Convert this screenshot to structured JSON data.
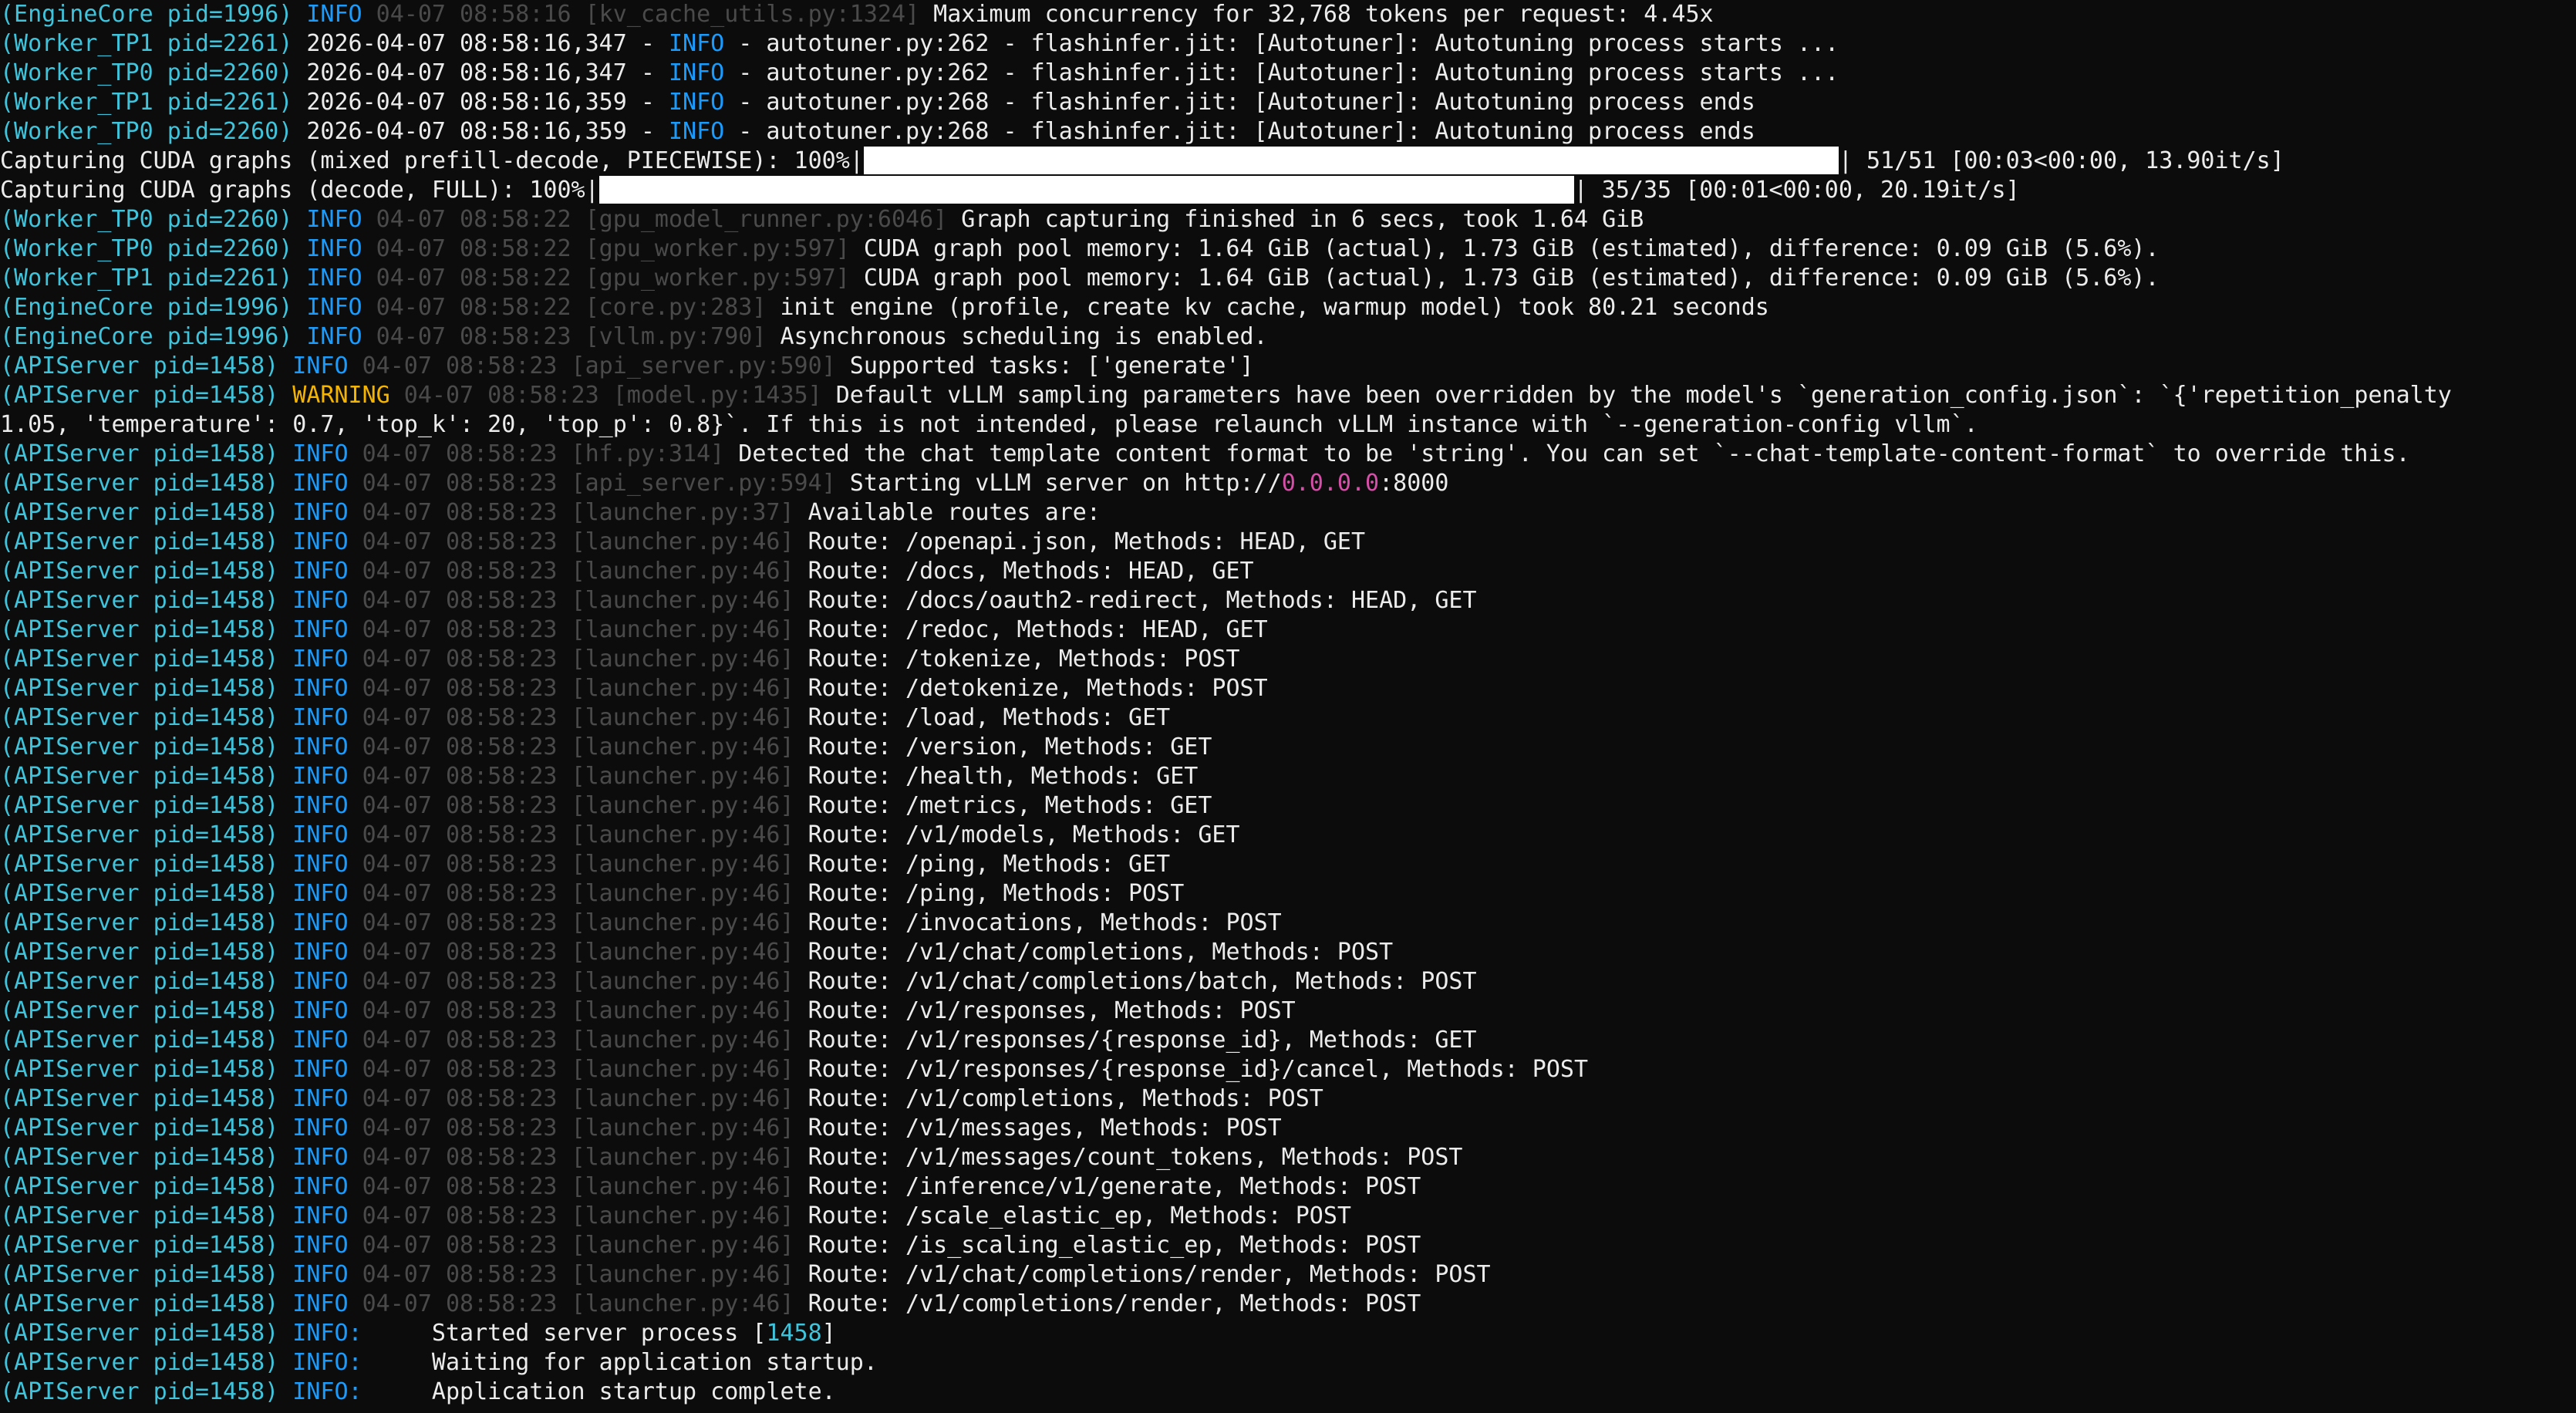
{
  "colors": {
    "background": "#0c0c0c",
    "prefix": "#3fc4dc",
    "info": "#1a9cff",
    "warning": "#f5b400",
    "meta": "#4a4a4a",
    "text": "#ececec",
    "url_highlight": "#d64fa8",
    "progress_fill": "#ffffff"
  },
  "lines": [
    {
      "type": "log",
      "prefix": "(EngineCore pid=1996)",
      "level": "INFO",
      "meta": "04-07 08:58:16 [kv_cache_utils.py:1324]",
      "msg": "Maximum concurrency for 32,768 tokens per request: 4.45x"
    },
    {
      "type": "plain",
      "prefix": "(Worker_TP1 pid=2261)",
      "pre": "2026-04-07 08:58:16,347 - ",
      "level": "INFO",
      "msg": " - autotuner.py:262 - flashinfer.jit: [Autotuner]: Autotuning process starts ..."
    },
    {
      "type": "plain",
      "prefix": "(Worker_TP0 pid=2260)",
      "pre": "2026-04-07 08:58:16,347 - ",
      "level": "INFO",
      "msg": " - autotuner.py:262 - flashinfer.jit: [Autotuner]: Autotuning process starts ..."
    },
    {
      "type": "plain",
      "prefix": "(Worker_TP1 pid=2261)",
      "pre": "2026-04-07 08:58:16,359 - ",
      "level": "INFO",
      "msg": " - autotuner.py:268 - flashinfer.jit: [Autotuner]: Autotuning process ends"
    },
    {
      "type": "plain",
      "prefix": "(Worker_TP0 pid=2260)",
      "pre": "2026-04-07 08:58:16,359 - ",
      "level": "INFO",
      "msg": " - autotuner.py:268 - flashinfer.jit: [Autotuner]: Autotuning process ends"
    },
    {
      "type": "progress",
      "label": "Capturing CUDA graphs (mixed prefill-decode, PIECEWISE): 100%|",
      "progress": 1.0,
      "stats": "| 51/51 [00:03<00:00, 13.90it/s]"
    },
    {
      "type": "progress",
      "label": "Capturing CUDA graphs (decode, FULL): 100%|",
      "progress": 1.0,
      "stats": "| 35/35 [00:01<00:00, 20.19it/s]"
    },
    {
      "type": "log",
      "prefix": "(Worker_TP0 pid=2260)",
      "level": "INFO",
      "meta": "04-07 08:58:22 [gpu_model_runner.py:6046]",
      "msg": "Graph capturing finished in 6 secs, took 1.64 GiB"
    },
    {
      "type": "log",
      "prefix": "(Worker_TP0 pid=2260)",
      "level": "INFO",
      "meta": "04-07 08:58:22 [gpu_worker.py:597]",
      "msg": "CUDA graph pool memory: 1.64 GiB (actual), 1.73 GiB (estimated), difference: 0.09 GiB (5.6%)."
    },
    {
      "type": "log",
      "prefix": "(Worker_TP1 pid=2261)",
      "level": "INFO",
      "meta": "04-07 08:58:22 [gpu_worker.py:597]",
      "msg": "CUDA graph pool memory: 1.64 GiB (actual), 1.73 GiB (estimated), difference: 0.09 GiB (5.6%)."
    },
    {
      "type": "log",
      "prefix": "(EngineCore pid=1996)",
      "level": "INFO",
      "meta": "04-07 08:58:22 [core.py:283]",
      "msg": "init engine (profile, create kv cache, warmup model) took 80.21 seconds"
    },
    {
      "type": "log",
      "prefix": "(EngineCore pid=1996)",
      "level": "INFO",
      "meta": "04-07 08:58:23 [vllm.py:790]",
      "msg": "Asynchronous scheduling is enabled."
    },
    {
      "type": "log",
      "prefix": "(APIServer pid=1458)",
      "level": "INFO",
      "meta": "04-07 08:58:23 [api_server.py:590]",
      "msg": "Supported tasks: ['generate']"
    },
    {
      "type": "log",
      "prefix": "(APIServer pid=1458)",
      "level": "WARNING",
      "meta": "04-07 08:58:23 [model.py:1435]",
      "msg": "Default vLLM sampling parameters have been overridden by the model's `generation_config.json`: `{'repetition_penalty"
    },
    {
      "type": "text",
      "text": "1.05, 'temperature': 0.7, 'top_k': 20, 'top_p': 0.8}`. If this is not intended, please relaunch vLLM instance with `--generation-config vllm`."
    },
    {
      "type": "log",
      "prefix": "(APIServer pid=1458)",
      "level": "INFO",
      "meta": "04-07 08:58:23 [hf.py:314]",
      "msg": "Detected the chat template content format to be 'string'. You can set `--chat-template-content-format` to override this."
    },
    {
      "type": "url",
      "prefix": "(APIServer pid=1458)",
      "level": "INFO",
      "meta": "04-07 08:58:23 [api_server.py:594]",
      "msg_pre": "Starting vLLM server on http://",
      "msg_hl": "0.0.0.0",
      "msg_post": ":8000"
    },
    {
      "type": "log",
      "prefix": "(APIServer pid=1458)",
      "level": "INFO",
      "meta": "04-07 08:58:23 [launcher.py:37]",
      "msg": "Available routes are:"
    },
    {
      "type": "log",
      "prefix": "(APIServer pid=1458)",
      "level": "INFO",
      "meta": "04-07 08:58:23 [launcher.py:46]",
      "msg": "Route: /openapi.json, Methods: HEAD, GET"
    },
    {
      "type": "log",
      "prefix": "(APIServer pid=1458)",
      "level": "INFO",
      "meta": "04-07 08:58:23 [launcher.py:46]",
      "msg": "Route: /docs, Methods: HEAD, GET"
    },
    {
      "type": "log",
      "prefix": "(APIServer pid=1458)",
      "level": "INFO",
      "meta": "04-07 08:58:23 [launcher.py:46]",
      "msg": "Route: /docs/oauth2-redirect, Methods: HEAD, GET"
    },
    {
      "type": "log",
      "prefix": "(APIServer pid=1458)",
      "level": "INFO",
      "meta": "04-07 08:58:23 [launcher.py:46]",
      "msg": "Route: /redoc, Methods: HEAD, GET"
    },
    {
      "type": "log",
      "prefix": "(APIServer pid=1458)",
      "level": "INFO",
      "meta": "04-07 08:58:23 [launcher.py:46]",
      "msg": "Route: /tokenize, Methods: POST"
    },
    {
      "type": "log",
      "prefix": "(APIServer pid=1458)",
      "level": "INFO",
      "meta": "04-07 08:58:23 [launcher.py:46]",
      "msg": "Route: /detokenize, Methods: POST"
    },
    {
      "type": "log",
      "prefix": "(APIServer pid=1458)",
      "level": "INFO",
      "meta": "04-07 08:58:23 [launcher.py:46]",
      "msg": "Route: /load, Methods: GET"
    },
    {
      "type": "log",
      "prefix": "(APIServer pid=1458)",
      "level": "INFO",
      "meta": "04-07 08:58:23 [launcher.py:46]",
      "msg": "Route: /version, Methods: GET"
    },
    {
      "type": "log",
      "prefix": "(APIServer pid=1458)",
      "level": "INFO",
      "meta": "04-07 08:58:23 [launcher.py:46]",
      "msg": "Route: /health, Methods: GET"
    },
    {
      "type": "log",
      "prefix": "(APIServer pid=1458)",
      "level": "INFO",
      "meta": "04-07 08:58:23 [launcher.py:46]",
      "msg": "Route: /metrics, Methods: GET"
    },
    {
      "type": "log",
      "prefix": "(APIServer pid=1458)",
      "level": "INFO",
      "meta": "04-07 08:58:23 [launcher.py:46]",
      "msg": "Route: /v1/models, Methods: GET"
    },
    {
      "type": "log",
      "prefix": "(APIServer pid=1458)",
      "level": "INFO",
      "meta": "04-07 08:58:23 [launcher.py:46]",
      "msg": "Route: /ping, Methods: GET"
    },
    {
      "type": "log",
      "prefix": "(APIServer pid=1458)",
      "level": "INFO",
      "meta": "04-07 08:58:23 [launcher.py:46]",
      "msg": "Route: /ping, Methods: POST"
    },
    {
      "type": "log",
      "prefix": "(APIServer pid=1458)",
      "level": "INFO",
      "meta": "04-07 08:58:23 [launcher.py:46]",
      "msg": "Route: /invocations, Methods: POST"
    },
    {
      "type": "log",
      "prefix": "(APIServer pid=1458)",
      "level": "INFO",
      "meta": "04-07 08:58:23 [launcher.py:46]",
      "msg": "Route: /v1/chat/completions, Methods: POST"
    },
    {
      "type": "log",
      "prefix": "(APIServer pid=1458)",
      "level": "INFO",
      "meta": "04-07 08:58:23 [launcher.py:46]",
      "msg": "Route: /v1/chat/completions/batch, Methods: POST"
    },
    {
      "type": "log",
      "prefix": "(APIServer pid=1458)",
      "level": "INFO",
      "meta": "04-07 08:58:23 [launcher.py:46]",
      "msg": "Route: /v1/responses, Methods: POST"
    },
    {
      "type": "log",
      "prefix": "(APIServer pid=1458)",
      "level": "INFO",
      "meta": "04-07 08:58:23 [launcher.py:46]",
      "msg": "Route: /v1/responses/{response_id}, Methods: GET"
    },
    {
      "type": "log",
      "prefix": "(APIServer pid=1458)",
      "level": "INFO",
      "meta": "04-07 08:58:23 [launcher.py:46]",
      "msg": "Route: /v1/responses/{response_id}/cancel, Methods: POST"
    },
    {
      "type": "log",
      "prefix": "(APIServer pid=1458)",
      "level": "INFO",
      "meta": "04-07 08:58:23 [launcher.py:46]",
      "msg": "Route: /v1/completions, Methods: POST"
    },
    {
      "type": "log",
      "prefix": "(APIServer pid=1458)",
      "level": "INFO",
      "meta": "04-07 08:58:23 [launcher.py:46]",
      "msg": "Route: /v1/messages, Methods: POST"
    },
    {
      "type": "log",
      "prefix": "(APIServer pid=1458)",
      "level": "INFO",
      "meta": "04-07 08:58:23 [launcher.py:46]",
      "msg": "Route: /v1/messages/count_tokens, Methods: POST"
    },
    {
      "type": "log",
      "prefix": "(APIServer pid=1458)",
      "level": "INFO",
      "meta": "04-07 08:58:23 [launcher.py:46]",
      "msg": "Route: /inference/v1/generate, Methods: POST"
    },
    {
      "type": "log",
      "prefix": "(APIServer pid=1458)",
      "level": "INFO",
      "meta": "04-07 08:58:23 [launcher.py:46]",
      "msg": "Route: /scale_elastic_ep, Methods: POST"
    },
    {
      "type": "log",
      "prefix": "(APIServer pid=1458)",
      "level": "INFO",
      "meta": "04-07 08:58:23 [launcher.py:46]",
      "msg": "Route: /is_scaling_elastic_ep, Methods: POST"
    },
    {
      "type": "log",
      "prefix": "(APIServer pid=1458)",
      "level": "INFO",
      "meta": "04-07 08:58:23 [launcher.py:46]",
      "msg": "Route: /v1/chat/completions/render, Methods: POST"
    },
    {
      "type": "log",
      "prefix": "(APIServer pid=1458)",
      "level": "INFO",
      "meta": "04-07 08:58:23 [launcher.py:46]",
      "msg": "Route: /v1/completions/render, Methods: POST"
    },
    {
      "type": "pid",
      "prefix": "(APIServer pid=1458)",
      "level": "INFO:",
      "msg_pre": "     Started server process [",
      "msg_hl": "1458",
      "msg_post": "]"
    },
    {
      "type": "uv",
      "prefix": "(APIServer pid=1458)",
      "level": "INFO:",
      "msg": "     Waiting for application startup."
    },
    {
      "type": "uv",
      "prefix": "(APIServer pid=1458)",
      "level": "INFO:",
      "msg": "     Application startup complete."
    }
  ]
}
